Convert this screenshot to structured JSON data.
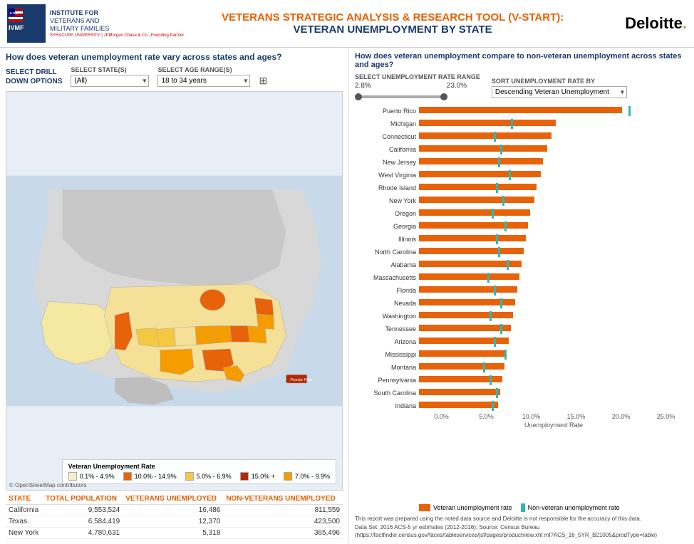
{
  "header": {
    "logo_institute_line1": "INSTITUTE FOR",
    "logo_institute_line2": "VETERANS AND",
    "logo_institute_line3": "MILITARY FAMILIES",
    "logo_sub": "SYRACUSE UNIVERSITY | JPMorgan Chase & Co., Founding Partner",
    "title_main": "VETERANS STRATEGIC ANALYSIS & RESEARCH TOOL (V-START):",
    "title_sub": "VETERAN UNEMPLOYMENT BY STATE",
    "deloitte": "Deloitte",
    "deloitte_dot": "."
  },
  "left": {
    "section_title": "How does veteran unemployment rate vary across states and ages?",
    "drill_label_line1": "SELECT DRILL",
    "drill_label_line2": "DOWN OPTIONS",
    "state_label": "SELECT STATE(S)",
    "state_value": "(All)",
    "age_label": "SELECT AGE RANGE(S)",
    "age_value": "18 to 34 years",
    "osm_credit": "© OpenStreetMap contributors",
    "legend": {
      "title": "Veteran Unemployment Rate",
      "items": [
        {
          "range": "0.1% - 4.9%",
          "color": "#f5f0c8"
        },
        {
          "range": "10.0% - 14.9%",
          "color": "#e8620a"
        },
        {
          "range": "5.0% - 6.9%",
          "color": "#f5c842"
        },
        {
          "range": "15.0% +",
          "color": "#b52a00"
        },
        {
          "range": "7.0% - 9.9%",
          "color": "#f59c00"
        }
      ]
    }
  },
  "table": {
    "headers": [
      "STATE",
      "TOTAL POPULATION",
      "VETERANS UNEMPLOYED",
      "NON-VETERANS UNEMPLOYED"
    ],
    "rows": [
      {
        "state": "California",
        "total_pop": "9,553,524",
        "vet_unemp": "16,486",
        "nonvet_unemp": "811,559"
      },
      {
        "state": "Texas",
        "total_pop": "6,584,419",
        "vet_unemp": "12,370",
        "nonvet_unemp": "423,500"
      },
      {
        "state": "New York",
        "total_pop": "4,780,631",
        "vet_unemp": "5,318",
        "nonvet_unemp": "365,496"
      }
    ]
  },
  "right": {
    "section_title": "How does veteran unemployment compare to non-veteran unemployment across states and ages?",
    "rate_range_label": "SELECT UNEMPLOYMENT RATE RANGE",
    "rate_min": "2.8%",
    "rate_max": "23.0%",
    "sort_label": "SORT UNEMPLOYMENT RATE BY",
    "sort_value": "Descending Veteran Unemployment",
    "x_axis_title": "Unemployment Rate",
    "x_labels": [
      "0.0%",
      "5.0%",
      "10.0%",
      "15.0%",
      "20.0%",
      "25.0%"
    ],
    "legend_vet": "Veteran unemployment rate",
    "legend_nonvet": "Non-veteran unemployment rate",
    "bars": [
      {
        "state": "Puerto Rico",
        "vet": 95,
        "nonvet": 98
      },
      {
        "state": "Michigan",
        "vet": 64,
        "nonvet": 43
      },
      {
        "state": "Connecticut",
        "vet": 62,
        "nonvet": 35
      },
      {
        "state": "California",
        "vet": 60,
        "nonvet": 38
      },
      {
        "state": "New Jersey",
        "vet": 58,
        "nonvet": 37
      },
      {
        "state": "West Virginia",
        "vet": 57,
        "nonvet": 42
      },
      {
        "state": "Rhode Island",
        "vet": 55,
        "nonvet": 36
      },
      {
        "state": "New York",
        "vet": 54,
        "nonvet": 39
      },
      {
        "state": "Oregon",
        "vet": 52,
        "nonvet": 34
      },
      {
        "state": "Georgia",
        "vet": 51,
        "nonvet": 40
      },
      {
        "state": "Illinois",
        "vet": 50,
        "nonvet": 36
      },
      {
        "state": "North Carolina",
        "vet": 49,
        "nonvet": 37
      },
      {
        "state": "Alabama",
        "vet": 48,
        "nonvet": 41
      },
      {
        "state": "Massachusetts",
        "vet": 47,
        "nonvet": 32
      },
      {
        "state": "Florida",
        "vet": 46,
        "nonvet": 35
      },
      {
        "state": "Nevada",
        "vet": 45,
        "nonvet": 38
      },
      {
        "state": "Washington",
        "vet": 44,
        "nonvet": 33
      },
      {
        "state": "Tennessee",
        "vet": 43,
        "nonvet": 38
      },
      {
        "state": "Arizona",
        "vet": 42,
        "nonvet": 35
      },
      {
        "state": "Mississippi",
        "vet": 41,
        "nonvet": 40
      },
      {
        "state": "Montana",
        "vet": 40,
        "nonvet": 30
      },
      {
        "state": "Pennsylvania",
        "vet": 39,
        "nonvet": 33
      },
      {
        "state": "South Carolina",
        "vet": 38,
        "nonvet": 36
      },
      {
        "state": "Indiana",
        "vet": 37,
        "nonvet": 34
      }
    ],
    "note": "This report was prepared using the noted data source and Deloitte is not responsible for the accuracy of this data.",
    "data_set": "Data Set: 2016 ACS-5 yr estimates (2012-2016); Source: Census Bureau (https://factfinder.census.gov/faces/tableservices/jsf/pages/productview.xht ml?ACS_16_5YR_B21005&prodType=table)"
  }
}
